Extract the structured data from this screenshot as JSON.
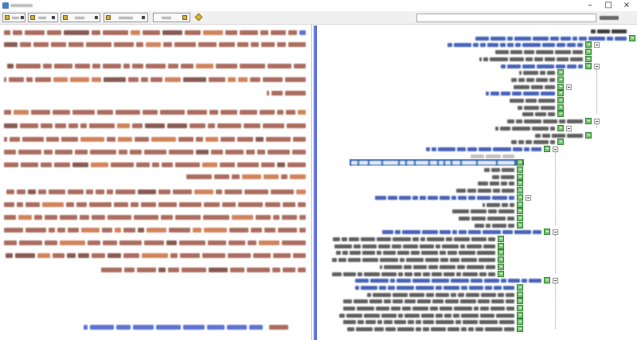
{
  "window": {
    "minimize_glyph": "–",
    "maximize_glyph": "□",
    "close_glyph": "×"
  },
  "colors": {
    "splitter": "#4a5fd6",
    "selection": "#3d6fb6",
    "body_text": "#8b3522",
    "body_text_accent": "#c0561e",
    "body_text_dark": "#5a1d12",
    "link_text": "#1f3fbf",
    "tree_heading": "#1b3ea8",
    "tree_item": "#1e1e1e",
    "tree_faint": "#9a9a9a",
    "node_icon": "#7cc576",
    "toolbar_bg": "#f0f0f0"
  },
  "toolbar": {
    "buttons": [
      {
        "icon": "yellow-square-icon"
      },
      {
        "icon": "yellow-square-icon"
      },
      {
        "icon": "yellow-square-icon",
        "dropdown_icon": "chevron-down-icon"
      },
      {
        "icon": "yellow-square-icon"
      },
      {
        "icon": "yellow-square-icon"
      }
    ],
    "extra_icon": "star-icon"
  },
  "tree": {
    "nodes": [
      {
        "depth": 0,
        "icon": null,
        "toggle": false,
        "style": "header"
      },
      {
        "depth": 0,
        "icon": "book-page-icon",
        "toggle": false,
        "style": "heading"
      },
      {
        "depth": 1,
        "icon": "book-page-icon",
        "toggle": true,
        "style": "heading"
      },
      {
        "depth": 1,
        "icon": "book-page-icon",
        "toggle": false,
        "style": "item"
      },
      {
        "depth": 1,
        "icon": "book-page-icon",
        "toggle": false,
        "style": "item"
      },
      {
        "depth": 1,
        "icon": "book-page-icon",
        "toggle": true,
        "style": "heading"
      },
      {
        "depth": 2,
        "icon": "book-page-icon",
        "toggle": false,
        "style": "item"
      },
      {
        "depth": 2,
        "icon": "book-page-icon",
        "toggle": false,
        "style": "item"
      },
      {
        "depth": 2,
        "icon": "book-page-icon",
        "toggle": true,
        "style": "item"
      },
      {
        "depth": 2,
        "icon": "book-page-icon",
        "toggle": false,
        "style": "heading"
      },
      {
        "depth": 2,
        "icon": "book-page-icon",
        "toggle": false,
        "style": "item"
      },
      {
        "depth": 2,
        "icon": "book-page-icon",
        "toggle": false,
        "style": "item"
      },
      {
        "depth": 2,
        "icon": "book-page-icon",
        "toggle": false,
        "style": "item"
      },
      {
        "depth": 1,
        "icon": "book-page-icon",
        "toggle": true,
        "style": "item"
      },
      {
        "depth": 2,
        "icon": "book-page-icon",
        "toggle": true,
        "style": "item"
      },
      {
        "depth": 1,
        "icon": "book-page-icon",
        "toggle": false,
        "style": "item"
      },
      {
        "depth": 2,
        "icon": "book-page-icon",
        "toggle": false,
        "style": "item"
      },
      {
        "depth": 3,
        "icon": "book-page-icon",
        "toggle": true,
        "style": "heading"
      },
      {
        "depth": 4,
        "icon": null,
        "toggle": false,
        "style": "faint"
      },
      {
        "depth": 4,
        "icon": "book-page-icon",
        "toggle": false,
        "style": "item",
        "selected": true
      },
      {
        "depth": 4,
        "icon": "book-page-icon",
        "toggle": false,
        "style": "item"
      },
      {
        "depth": 4,
        "icon": "book-page-icon",
        "toggle": false,
        "style": "item"
      },
      {
        "depth": 4,
        "icon": "book-page-icon",
        "toggle": false,
        "style": "item"
      },
      {
        "depth": 4,
        "icon": "book-page-icon",
        "toggle": false,
        "style": "item"
      },
      {
        "depth": 4,
        "icon": "book-page-icon",
        "toggle": true,
        "style": "heading"
      },
      {
        "depth": 4,
        "icon": "book-page-icon",
        "toggle": false,
        "style": "item"
      },
      {
        "depth": 4,
        "icon": "book-page-icon",
        "toggle": false,
        "style": "item"
      },
      {
        "depth": 4,
        "icon": "book-page-icon",
        "toggle": false,
        "style": "item"
      },
      {
        "depth": 4,
        "icon": "book-page-icon",
        "toggle": false,
        "style": "item"
      },
      {
        "depth": 3,
        "icon": "book-page-icon",
        "toggle": true,
        "style": "heading"
      },
      {
        "depth": 5,
        "icon": "book-page-icon",
        "toggle": false,
        "style": "item"
      },
      {
        "depth": 5,
        "icon": "book-page-icon",
        "toggle": false,
        "style": "item"
      },
      {
        "depth": 5,
        "icon": "book-page-icon",
        "toggle": false,
        "style": "item"
      },
      {
        "depth": 5,
        "icon": "book-page-icon",
        "toggle": false,
        "style": "item"
      },
      {
        "depth": 5,
        "icon": "book-page-icon",
        "toggle": false,
        "style": "item"
      },
      {
        "depth": 5,
        "icon": "book-page-icon",
        "toggle": false,
        "style": "item"
      },
      {
        "depth": 3,
        "icon": "book-page-icon",
        "toggle": true,
        "style": "heading"
      },
      {
        "depth": 4,
        "icon": "book-page-icon",
        "toggle": false,
        "style": "heading"
      },
      {
        "depth": 4,
        "icon": "book-page-icon",
        "toggle": false,
        "style": "item"
      },
      {
        "depth": 4,
        "icon": "book-page-icon",
        "toggle": false,
        "style": "item"
      },
      {
        "depth": 4,
        "icon": "book-page-icon",
        "toggle": false,
        "style": "item"
      },
      {
        "depth": 4,
        "icon": "book-page-icon",
        "toggle": false,
        "style": "item"
      },
      {
        "depth": 4,
        "icon": "book-page-icon",
        "toggle": false,
        "style": "item"
      },
      {
        "depth": 4,
        "icon": "book-page-icon",
        "toggle": false,
        "style": "item"
      }
    ]
  }
}
